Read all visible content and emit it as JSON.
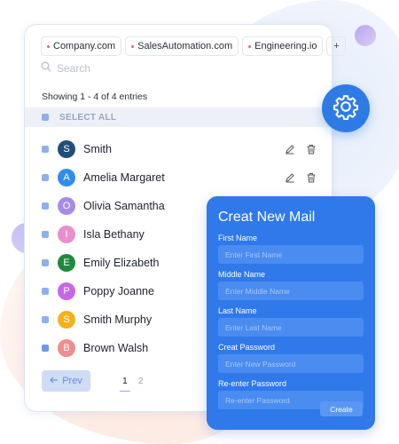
{
  "tags": [
    "Company.com",
    "SalesAutomation.com",
    "Engineering.io"
  ],
  "tag_add_label": "+",
  "search": {
    "placeholder": "Search"
  },
  "table": {
    "showing_text": "Showing 1 - 4 of 4 entries",
    "select_all_label": "SELECT ALL",
    "rows": [
      {
        "initial": "S",
        "name": "Smith",
        "color": "#1f4e79"
      },
      {
        "initial": "A",
        "name": "Amelia Margaret",
        "color": "#2f8fe8"
      },
      {
        "initial": "O",
        "name": "Olivia Samantha",
        "color": "#a88be6"
      },
      {
        "initial": "I",
        "name": "Isla Bethany",
        "color": "#e88fd0"
      },
      {
        "initial": "E",
        "name": "Emily Elizabeth",
        "color": "#1e8a3c"
      },
      {
        "initial": "P",
        "name": "Poppy Joanne",
        "color": "#c667e8"
      },
      {
        "initial": "S",
        "name": "Smith Murphy",
        "color": "#f2b21c"
      },
      {
        "initial": "B",
        "name": "Brown Walsh",
        "color": "#ef8e8e"
      }
    ]
  },
  "pagination": {
    "prev_label": "Prev",
    "pages": [
      "1",
      "2"
    ]
  },
  "mail_form": {
    "title": "Creat New Mail",
    "fields": [
      {
        "label": "First Name",
        "placeholder": "Enter First Name"
      },
      {
        "label": "Middle Name",
        "placeholder": "Enter Middle Name"
      },
      {
        "label": "Last Name",
        "placeholder": "Enter Last Name"
      },
      {
        "label": "Creat Password",
        "placeholder": "Enter New Password"
      },
      {
        "label": "Re-enter Password",
        "placeholder": "Re-enter Password"
      }
    ],
    "create_label": "Create"
  },
  "colors": {
    "accent": "#2f79ea",
    "gear": "#2e7be6",
    "checkbox": "#8fb0e8"
  },
  "icons": {
    "search": "search-icon",
    "edit": "pencil-icon",
    "delete": "trash-icon",
    "settings": "gear-icon",
    "prev": "arrow-left-icon"
  }
}
